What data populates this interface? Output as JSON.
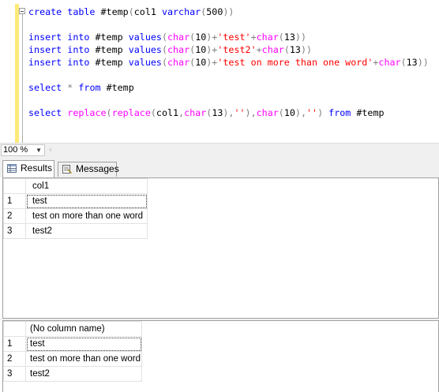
{
  "editor": {
    "lines": [
      [
        {
          "t": "create",
          "c": "kw"
        },
        {
          "t": " ",
          "c": "id"
        },
        {
          "t": "table",
          "c": "kw"
        },
        {
          "t": " #temp",
          "c": "id"
        },
        {
          "t": "(",
          "c": "op"
        },
        {
          "t": "col1 ",
          "c": "id"
        },
        {
          "t": "varchar",
          "c": "kw"
        },
        {
          "t": "(",
          "c": "op"
        },
        {
          "t": "500",
          "c": "id"
        },
        {
          "t": "))",
          "c": "op"
        }
      ],
      [],
      [
        {
          "t": "insert",
          "c": "kw"
        },
        {
          "t": " ",
          "c": "id"
        },
        {
          "t": "into",
          "c": "kw"
        },
        {
          "t": " #temp ",
          "c": "id"
        },
        {
          "t": "values",
          "c": "kw"
        },
        {
          "t": "(",
          "c": "op"
        },
        {
          "t": "char",
          "c": "fn"
        },
        {
          "t": "(",
          "c": "op"
        },
        {
          "t": "10",
          "c": "id"
        },
        {
          "t": ")+",
          "c": "op"
        },
        {
          "t": "'test'",
          "c": "str"
        },
        {
          "t": "+",
          "c": "op"
        },
        {
          "t": "char",
          "c": "fn"
        },
        {
          "t": "(",
          "c": "op"
        },
        {
          "t": "13",
          "c": "id"
        },
        {
          "t": "))",
          "c": "op"
        }
      ],
      [
        {
          "t": "insert",
          "c": "kw"
        },
        {
          "t": " ",
          "c": "id"
        },
        {
          "t": "into",
          "c": "kw"
        },
        {
          "t": " #temp ",
          "c": "id"
        },
        {
          "t": "values",
          "c": "kw"
        },
        {
          "t": "(",
          "c": "op"
        },
        {
          "t": "char",
          "c": "fn"
        },
        {
          "t": "(",
          "c": "op"
        },
        {
          "t": "10",
          "c": "id"
        },
        {
          "t": ")+",
          "c": "op"
        },
        {
          "t": "'test2'",
          "c": "str"
        },
        {
          "t": "+",
          "c": "op"
        },
        {
          "t": "char",
          "c": "fn"
        },
        {
          "t": "(",
          "c": "op"
        },
        {
          "t": "13",
          "c": "id"
        },
        {
          "t": "))",
          "c": "op"
        }
      ],
      [
        {
          "t": "insert",
          "c": "kw"
        },
        {
          "t": " ",
          "c": "id"
        },
        {
          "t": "into",
          "c": "kw"
        },
        {
          "t": " #temp ",
          "c": "id"
        },
        {
          "t": "values",
          "c": "kw"
        },
        {
          "t": "(",
          "c": "op"
        },
        {
          "t": "char",
          "c": "fn"
        },
        {
          "t": "(",
          "c": "op"
        },
        {
          "t": "10",
          "c": "id"
        },
        {
          "t": ")+",
          "c": "op"
        },
        {
          "t": "'test on more than one word'",
          "c": "str"
        },
        {
          "t": "+",
          "c": "op"
        },
        {
          "t": "char",
          "c": "fn"
        },
        {
          "t": "(",
          "c": "op"
        },
        {
          "t": "13",
          "c": "id"
        },
        {
          "t": "))",
          "c": "op"
        }
      ],
      [],
      [
        {
          "t": "select",
          "c": "kw"
        },
        {
          "t": " ",
          "c": "id"
        },
        {
          "t": "*",
          "c": "op"
        },
        {
          "t": " ",
          "c": "id"
        },
        {
          "t": "from",
          "c": "kw"
        },
        {
          "t": " #temp",
          "c": "id"
        }
      ],
      [],
      [
        {
          "t": "select",
          "c": "kw"
        },
        {
          "t": " ",
          "c": "id"
        },
        {
          "t": "replace",
          "c": "fn"
        },
        {
          "t": "(",
          "c": "op"
        },
        {
          "t": "replace",
          "c": "fn"
        },
        {
          "t": "(",
          "c": "op"
        },
        {
          "t": "col1",
          "c": "id"
        },
        {
          "t": ",",
          "c": "op"
        },
        {
          "t": "char",
          "c": "fn"
        },
        {
          "t": "(",
          "c": "op"
        },
        {
          "t": "13",
          "c": "id"
        },
        {
          "t": "),",
          "c": "op"
        },
        {
          "t": "''",
          "c": "str"
        },
        {
          "t": "),",
          "c": "op"
        },
        {
          "t": "char",
          "c": "fn"
        },
        {
          "t": "(",
          "c": "op"
        },
        {
          "t": "10",
          "c": "id"
        },
        {
          "t": "),",
          "c": "op"
        },
        {
          "t": "''",
          "c": "str"
        },
        {
          "t": ")",
          "c": "op"
        },
        {
          "t": " ",
          "c": "id"
        },
        {
          "t": "from",
          "c": "kw"
        },
        {
          "t": " #temp",
          "c": "id"
        }
      ]
    ]
  },
  "zoom": {
    "value": "100 %",
    "arrow_icon": "chevron-down-icon",
    "scroll_left_icon": "chevron-left-icon"
  },
  "tabs": {
    "results": "Results",
    "messages": "Messages"
  },
  "grid1": {
    "header": "col1",
    "rows": [
      {
        "num": "1",
        "value": "test"
      },
      {
        "num": "2",
        "value": "test on more than one word"
      },
      {
        "num": "3",
        "value": "test2"
      }
    ]
  },
  "grid2": {
    "header": "(No column name)",
    "rows": [
      {
        "num": "1",
        "value": "test"
      },
      {
        "num": "2",
        "value": "test on more than one word"
      },
      {
        "num": "3",
        "value": "test2"
      }
    ]
  },
  "colors": {
    "keyword": "#0000ff",
    "function": "#ff00ff",
    "string": "#ff0000",
    "operator": "#808080",
    "change_bar": "#ffe97a"
  }
}
